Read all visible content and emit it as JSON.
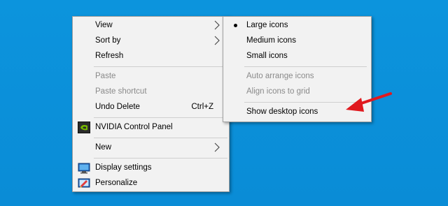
{
  "context_menu": {
    "items": {
      "view": {
        "label": "View"
      },
      "sort_by": {
        "label": "Sort by"
      },
      "refresh": {
        "label": "Refresh"
      },
      "paste": {
        "label": "Paste"
      },
      "paste_shortcut": {
        "label": "Paste shortcut"
      },
      "undo_delete": {
        "label": "Undo Delete",
        "shortcut": "Ctrl+Z"
      },
      "nvidia": {
        "label": "NVIDIA Control Panel",
        "icon": "nvidia-icon"
      },
      "new": {
        "label": "New"
      },
      "display_settings": {
        "label": "Display settings",
        "icon": "display-icon"
      },
      "personalize": {
        "label": "Personalize",
        "icon": "personalize-icon"
      }
    }
  },
  "view_submenu": {
    "large_icons": {
      "label": "Large icons",
      "checked": true
    },
    "medium_icons": {
      "label": "Medium icons"
    },
    "small_icons": {
      "label": "Small icons"
    },
    "auto_arrange": {
      "label": "Auto arrange icons"
    },
    "align_grid": {
      "label": "Align icons to grid"
    },
    "show_desktop_icons": {
      "label": "Show desktop icons"
    }
  },
  "colors": {
    "desktop": "#0a8fd8",
    "menu_bg": "#f2f2f2",
    "annotation_arrow": "#e0191e"
  }
}
